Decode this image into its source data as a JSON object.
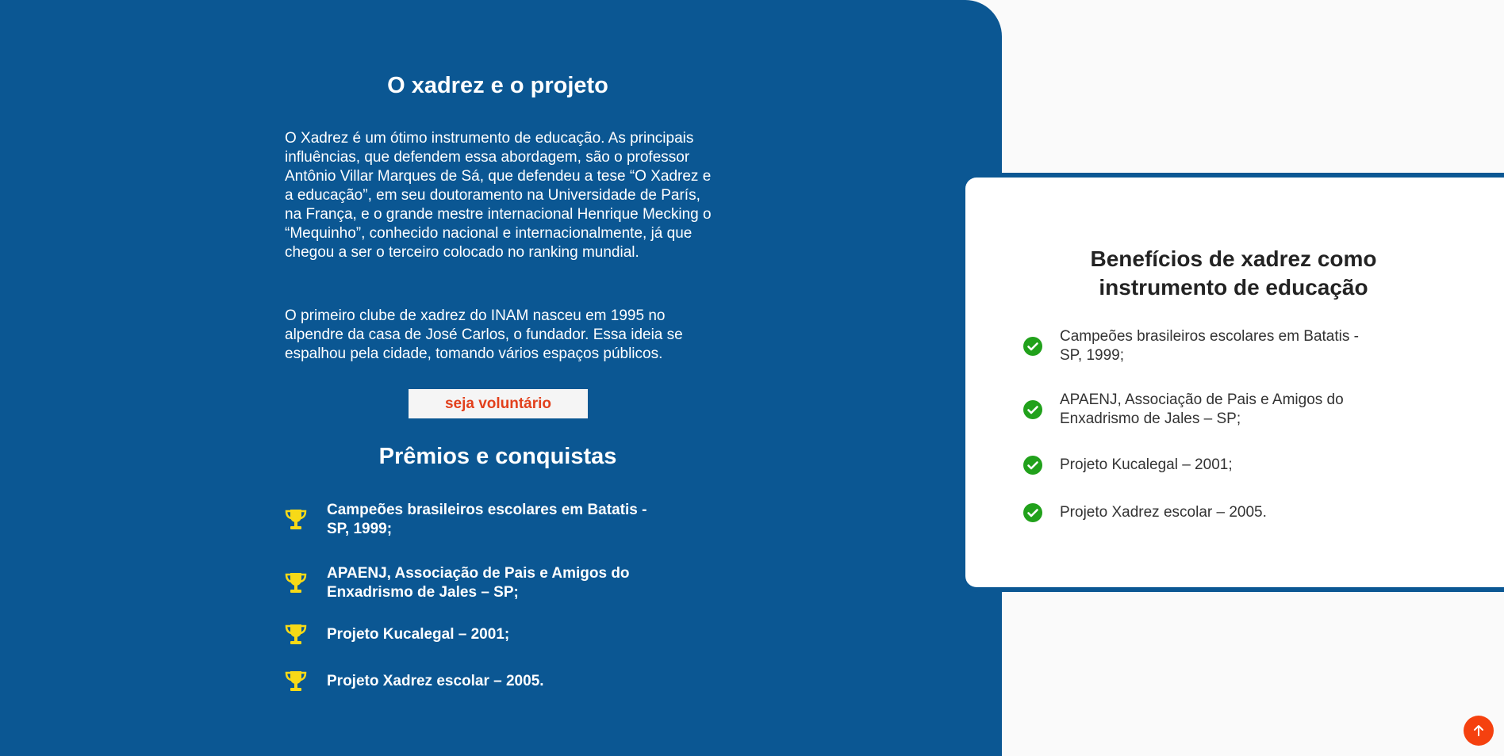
{
  "about": {
    "title": "O xadrez e o projeto",
    "paragraph_1": "O Xadrez é um ótimo instrumento de educação. As principais influências, que defendem essa abordagem, são o professor Antônio Villar Marques de Sá, que defendeu a tese “O Xadrez e a educação”, em seu doutoramento na Universidade de París, na França, e o grande mestre internacional Henrique Mecking o “Mequinho”, conhecido nacional e internacionalmente, já que chegou a ser o terceiro colocado no ranking mundial.",
    "paragraph_2": "O primeiro clube de xadrez do INAM nasceu em 1995 no alpendre da casa de José Carlos, o fundador. Essa ideia se espalhou pela cidade, tomando vários espaços públicos.",
    "volunteer_button": "seja voluntário"
  },
  "awards": {
    "title": "Prêmios e conquistas",
    "icon": "trophy-icon",
    "icon_color": "#f7d917",
    "items": [
      "Campeões brasileiros escolares em Batatis - SP, 1999;",
      "APAENJ, Associação de Pais e Amigos do Enxadrismo de Jales – SP;",
      "Projeto Kucalegal – 2001;",
      "Projeto Xadrez escolar – 2005."
    ]
  },
  "benefits": {
    "title": "Benefícios de xadrez como instrumento de educação",
    "icon": "check-circle-icon",
    "icon_color": "#21a11b",
    "items": [
      "Campeões brasileiros escolares em Batatis - SP, 1999;",
      "APAENJ, Associação de Pais e Amigos do Enxadrismo de Jales – SP;",
      "Projeto Kucalegal – 2001;",
      "Projeto Xadrez escolar – 2005."
    ]
  },
  "scroll_top": {
    "icon": "arrow-up-icon"
  },
  "colors": {
    "primary_blue": "#0b5793",
    "accent_orange": "#f5410f",
    "button_text": "#e2401c",
    "background": "#fafafa"
  }
}
